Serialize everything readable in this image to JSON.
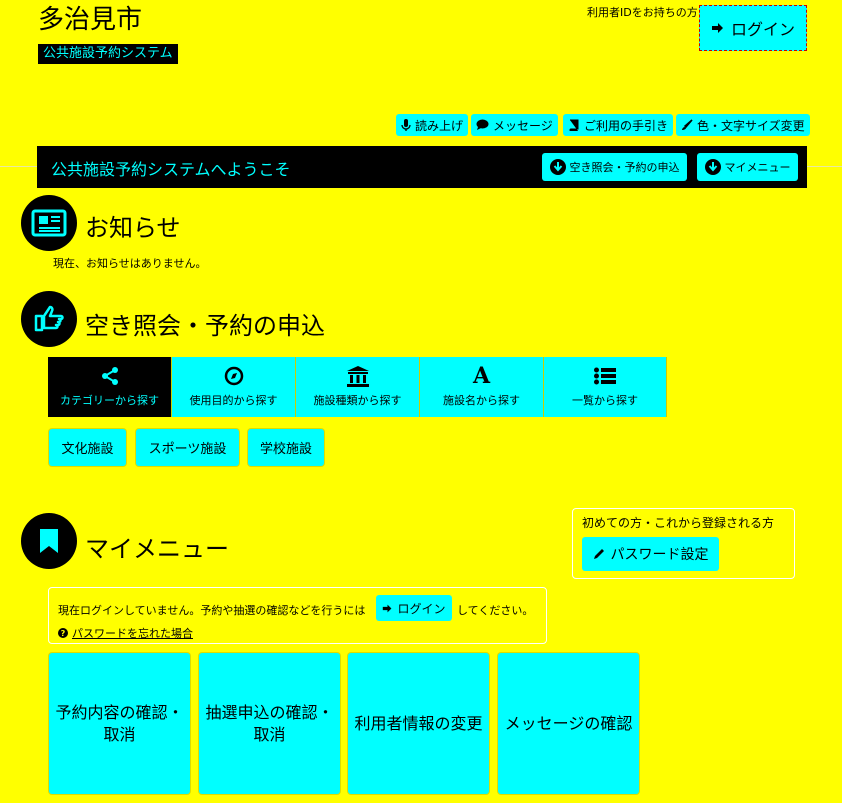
{
  "header": {
    "city": "多治見市",
    "system_badge": "公共施設予約システム",
    "login_hint": "利用者IDをお持ちの方",
    "login_label": "ログイン"
  },
  "toolbar": {
    "read_aloud": "読み上げ",
    "message": "メッセージ",
    "guide": "ご利用の手引き",
    "color_size": "色・文字サイズ変更"
  },
  "welcome": {
    "title": "公共施設予約システムへようこそ",
    "jump_reserve": "空き照会・予約の申込",
    "jump_mymenu": "マイメニュー"
  },
  "notice": {
    "title": "お知らせ",
    "text": "現在、お知らせはありません。"
  },
  "reserve": {
    "title": "空き照会・予約の申込",
    "tabs": [
      {
        "label": "カテゴリーから探す",
        "icon": "share-icon"
      },
      {
        "label": "使用目的から探す",
        "icon": "compass-icon"
      },
      {
        "label": "施設種類から探す",
        "icon": "institution-icon"
      },
      {
        "label": "施設名から探す",
        "icon": "font-icon"
      },
      {
        "label": "一覧から探す",
        "icon": "list-icon"
      }
    ],
    "categories": [
      "文化施設",
      "スポーツ施設",
      "学校施設"
    ]
  },
  "mymenu": {
    "title": "マイメニュー",
    "first_time": "初めての方・これから登録される方",
    "password_set": "パスワード設定",
    "status_before": "現在ログインしていません。予約や抽選の確認などを行うには",
    "status_login": "ログイン",
    "status_after": "してください。",
    "forgot": "パスワードを忘れた場合",
    "cards": [
      "予約内容の確認・\n取消",
      "抽選申込の確認・\n取消",
      "利用者情報の変更",
      "メッセージの確認"
    ]
  },
  "colors": {
    "background": "#ffff00",
    "button": "#00ffff",
    "dark": "#000000",
    "badge_text": "#00ffff"
  }
}
